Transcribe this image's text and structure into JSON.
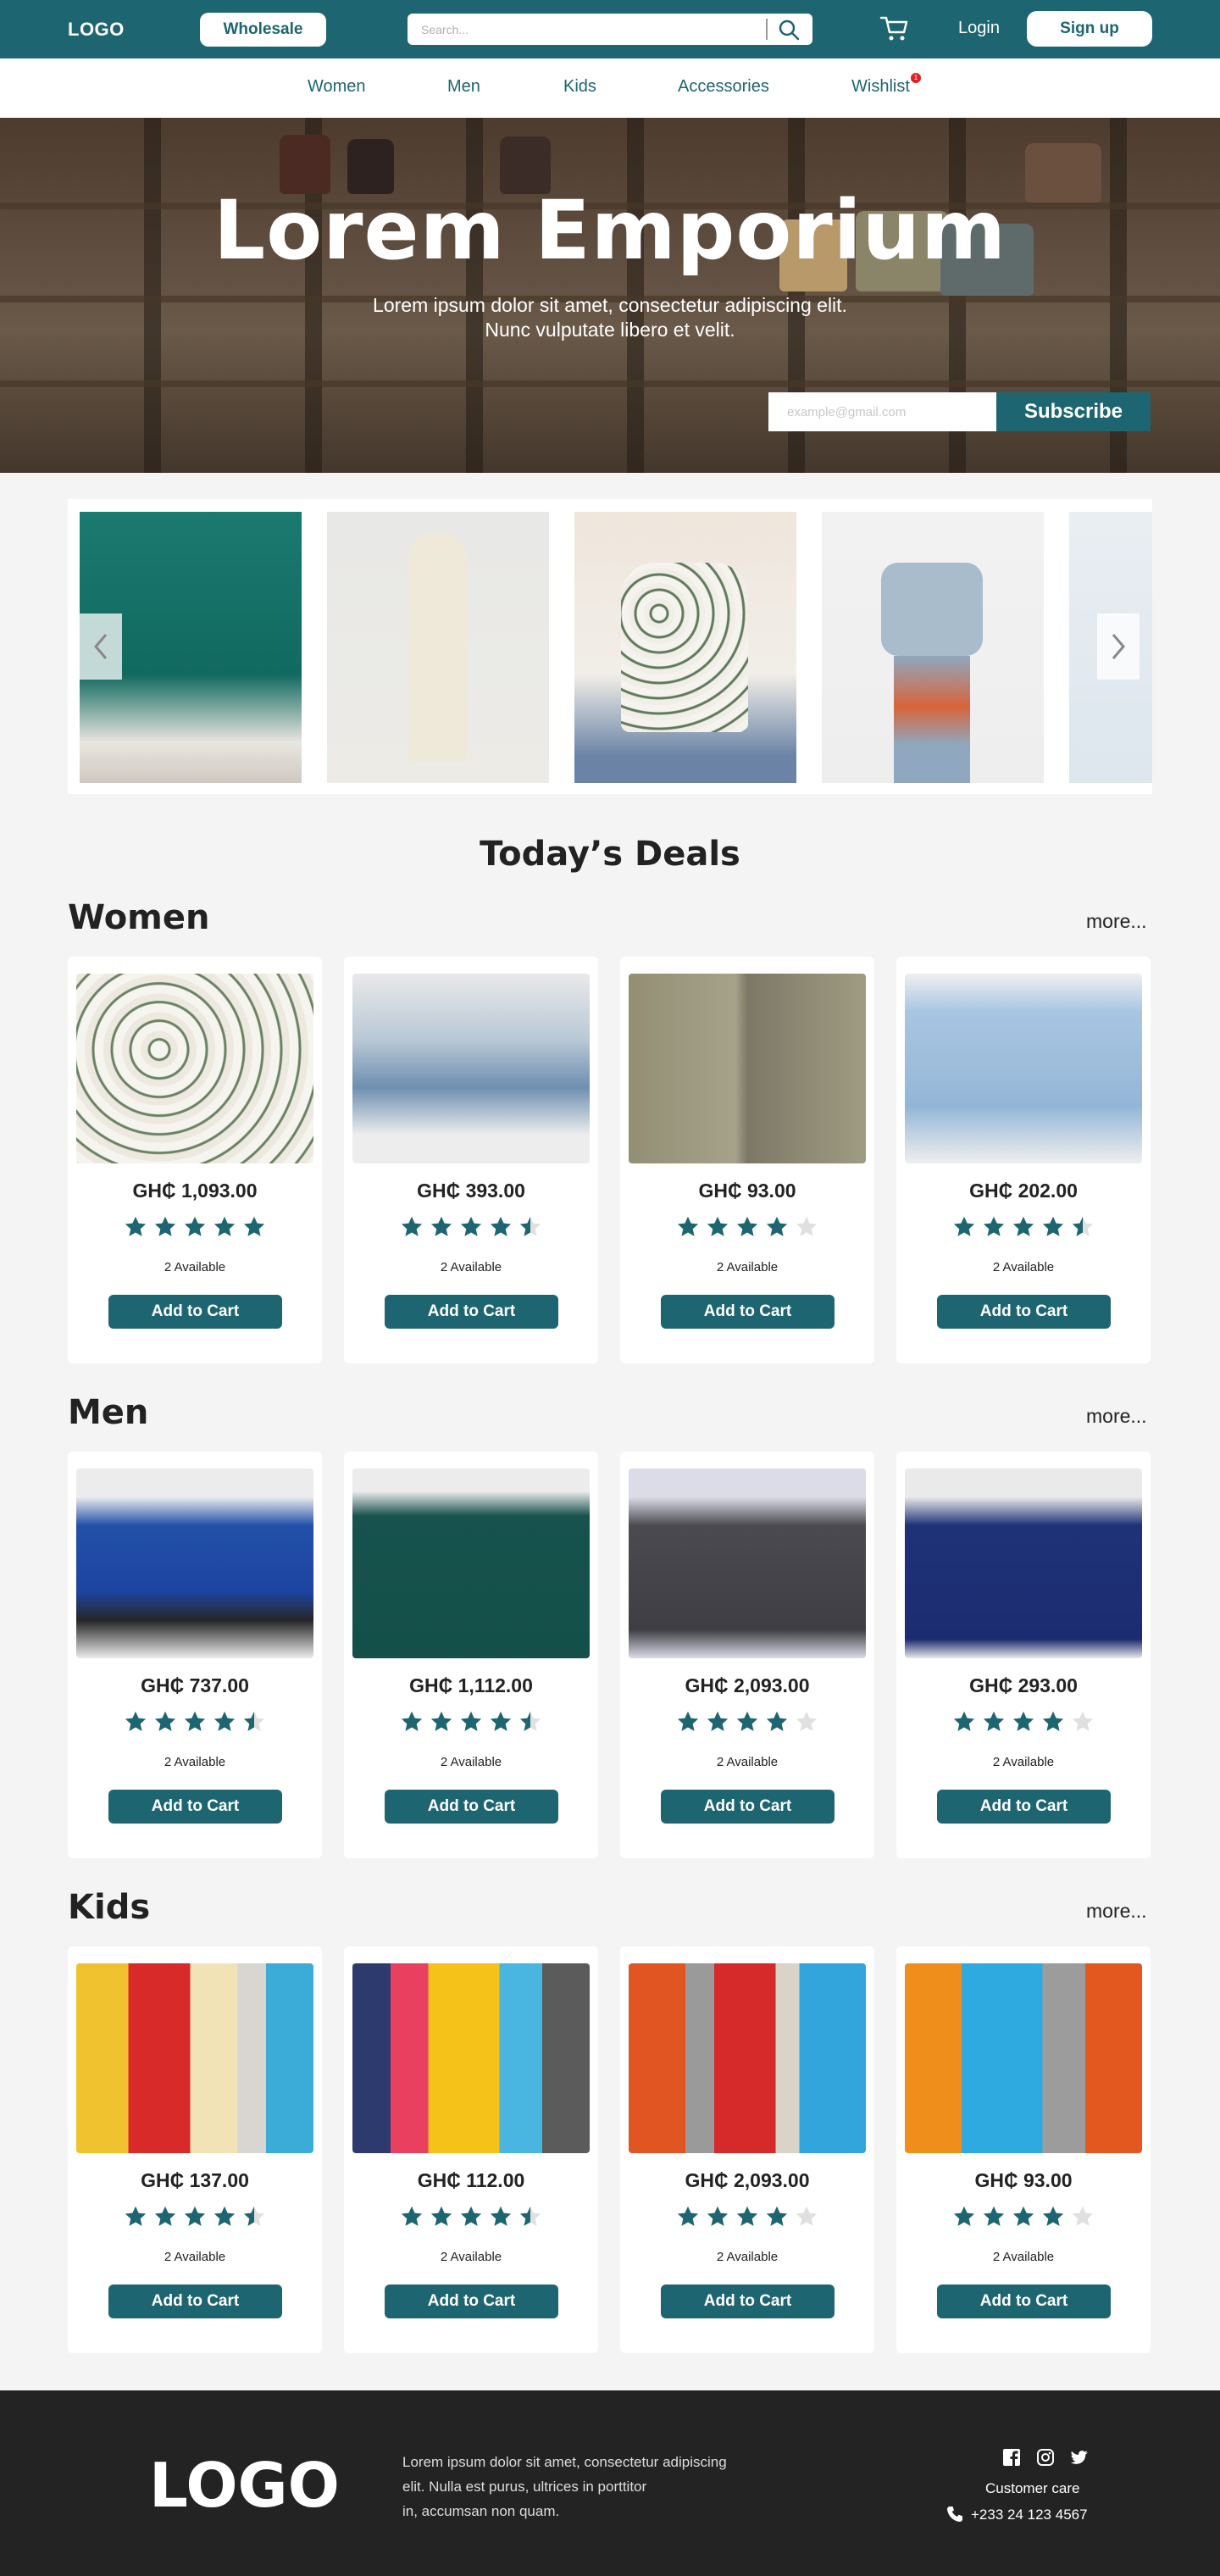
{
  "header": {
    "logo": "LOGO",
    "wholesale_label": "Wholesale",
    "search_placeholder": "Search...",
    "login_label": "Login",
    "signup_label": "Sign up"
  },
  "nav": {
    "items": [
      "Women",
      "Men",
      "Kids",
      "Accessories",
      "Wishlist"
    ],
    "wishlist_badge": "1"
  },
  "hero": {
    "title": "Lorem Emporium",
    "subtitle_line1": "Lorem ipsum dolor sit amet, consectetur adipiscing elit.",
    "subtitle_line2": "Nunc vulputate libero et velit.",
    "email_placeholder": "example@gmail.com",
    "subscribe_label": "Subscribe"
  },
  "deals_title": "Today’s Deals",
  "more_label": "more...",
  "add_to_cart_label": "Add to Cart",
  "sections": [
    {
      "title": "Women",
      "products": [
        {
          "price": "GH₵ 1,093.00",
          "rating": 5,
          "available": "2 Available"
        },
        {
          "price": "GH₵ 393.00",
          "rating": 4.5,
          "available": "2 Available"
        },
        {
          "price": "GH₵ 93.00",
          "rating": 4,
          "available": "2 Available"
        },
        {
          "price": "GH₵ 202.00",
          "rating": 4.5,
          "available": "2 Available"
        }
      ]
    },
    {
      "title": "Men",
      "products": [
        {
          "price": "GH₵ 737.00",
          "rating": 4.5,
          "available": "2 Available"
        },
        {
          "price": "GH₵ 1,112.00",
          "rating": 4.5,
          "available": "2 Available"
        },
        {
          "price": "GH₵ 2,093.00",
          "rating": 4,
          "available": "2 Available"
        },
        {
          "price": "GH₵ 293.00",
          "rating": 4,
          "available": "2 Available"
        }
      ]
    },
    {
      "title": "Kids",
      "products": [
        {
          "price": "GH₵ 137.00",
          "rating": 4.5,
          "available": "2 Available"
        },
        {
          "price": "GH₵ 112.00",
          "rating": 4.5,
          "available": "2 Available"
        },
        {
          "price": "GH₵ 2,093.00",
          "rating": 4,
          "available": "2 Available"
        },
        {
          "price": "GH₵ 93.00",
          "rating": 4,
          "available": "2 Available"
        }
      ]
    }
  ],
  "footer": {
    "logo": "LOGO",
    "text_line1": "Lorem ipsum dolor sit amet, consectetur adipiscing",
    "text_line2": "elit. Nulla est purus, ultrices in porttitor",
    "text_line3": "in, accumsan non quam.",
    "customer_care": "Customer care",
    "phone": "+233 24 123 4567"
  },
  "colors": {
    "primary": "#1d6570",
    "star_filled": "#1d6570",
    "star_empty": "#e0e0e0",
    "footer_bg": "#232323"
  },
  "icons": [
    "search-icon",
    "cart-icon",
    "chevron-left-icon",
    "chevron-right-icon",
    "facebook-icon",
    "instagram-icon",
    "twitter-icon",
    "phone-icon"
  ]
}
